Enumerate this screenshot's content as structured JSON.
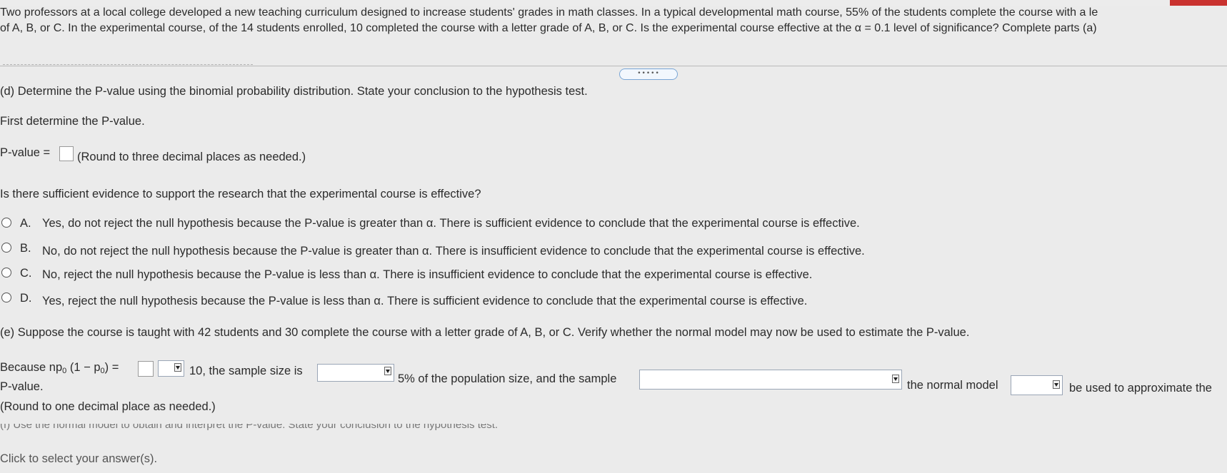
{
  "intro": {
    "line1": "Two professors at a local college developed a new teaching curriculum designed to increase students' grades in math classes. In a typical developmental math course, 55% of the students complete the course with a le",
    "line2": "of A, B, or C. In the experimental course, of the 14 students enrolled, 10 completed the course with a letter grade of A, B, or C. Is the experimental course effective at the α = 0.1 level of significance? Complete parts (a)"
  },
  "expand_label": "•••••",
  "part_d": {
    "heading": "(d) Determine the P-value using the binomial probability distribution. State your conclusion to the hypothesis test.",
    "first_line": "First determine the P-value.",
    "pvalue_label": "P-value =",
    "pvalue_value": "",
    "round_note": "(Round to three decimal places as needed.)",
    "question": "Is there sufficient evidence to support the research that the experimental course is effective?",
    "options": [
      {
        "letter": "A.",
        "text": "Yes, do not reject the null hypothesis because the P-value is greater than α. There is sufficient evidence to conclude that the experimental course is effective."
      },
      {
        "letter": "B.",
        "text": "No, do not reject the null hypothesis because the P-value is greater than α. There is insufficient evidence to conclude that the experimental course is effective."
      },
      {
        "letter": "C.",
        "text": "No, reject the null hypothesis because the P-value is less than α. There is insufficient evidence to conclude that the experimental course is effective."
      },
      {
        "letter": "D.",
        "text": "Yes, reject the null hypothesis because the P-value is less than α. There is sufficient evidence to conclude that the experimental course is effective."
      }
    ]
  },
  "part_e": {
    "heading": "(e) Suppose the course is taught with 42 students and 30 complete the course with a letter grade of A, B, or C. Verify whether the normal model may now be used to estimate the P-value.",
    "because": "Because np",
    "sub0": "0",
    "paren_open": "(1 − p",
    "paren_close": ") =",
    "after_ten": "10, the sample size is",
    "pct_text": "5% of the population size, and the sample",
    "normal_model": "the normal model",
    "be_used": "be used to approximate the",
    "pvalue_word": "P-value.",
    "round_note": "(Round to one decimal place as needed.)"
  },
  "part_f_cut": "(f) Use the normal model to obtain and interpret the P-value. State your conclusion to the hypothesis test.",
  "footer": "Click to select your answer(s)."
}
